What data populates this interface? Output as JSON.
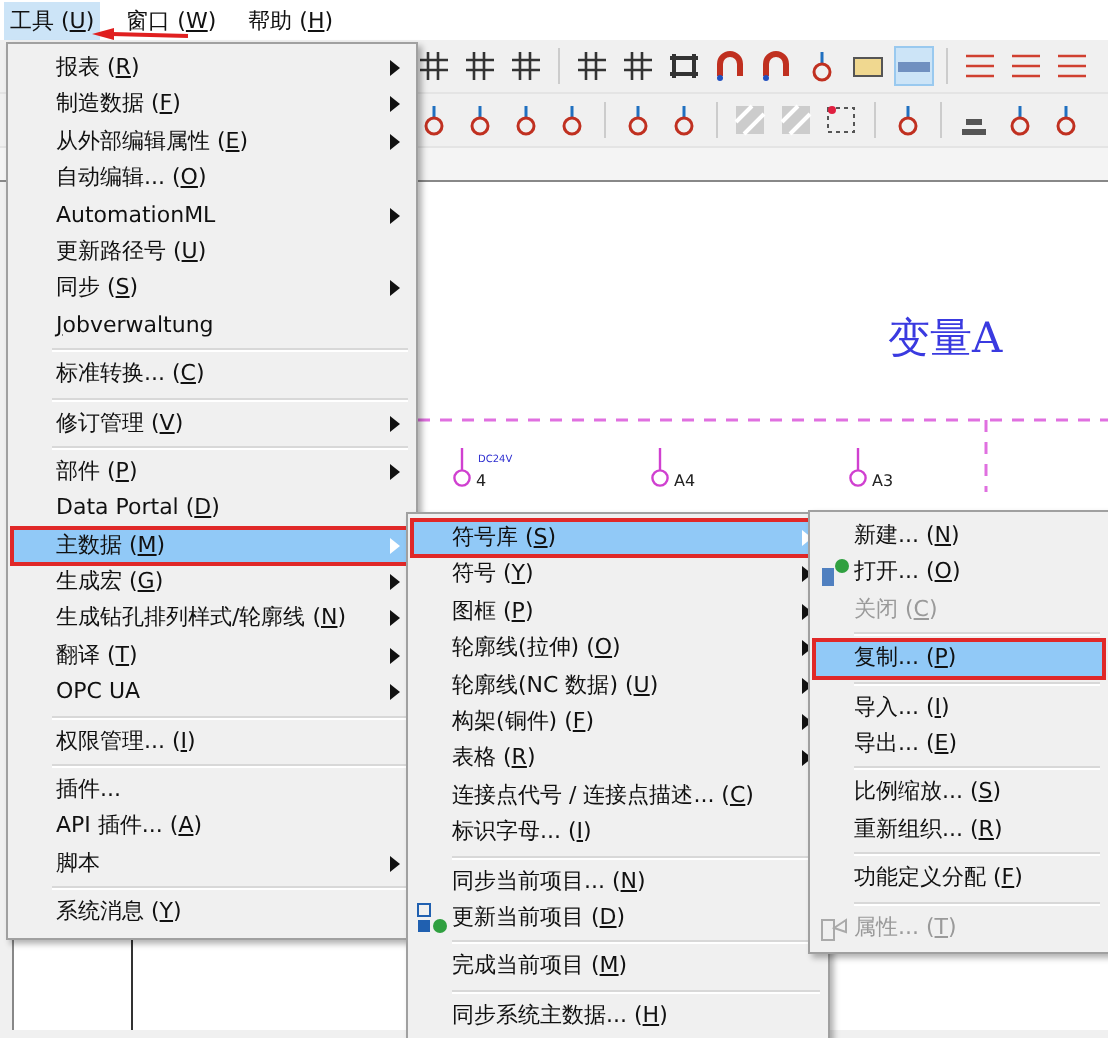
{
  "menu_bar": [
    {
      "before": "工具 (",
      "key": "U",
      "after": ")",
      "selected": true,
      "pointed": true
    },
    {
      "before": "窗口 (",
      "key": "W",
      "after": ")",
      "selected": false,
      "pointed": false
    },
    {
      "before": "帮助 (",
      "key": "H",
      "after": ")",
      "selected": false,
      "pointed": false
    }
  ],
  "tools_menu": {
    "items": [
      {
        "kind": "item",
        "before": "报表 (",
        "key": "R",
        "after": ")",
        "submenu": true,
        "selected": false,
        "marked": false
      },
      {
        "kind": "item",
        "before": "制造数据 (",
        "key": "F",
        "after": ")",
        "submenu": true,
        "selected": false,
        "marked": false
      },
      {
        "kind": "item",
        "before": "从外部编辑属性 (",
        "key": "E",
        "after": ")",
        "submenu": true,
        "selected": false,
        "marked": false
      },
      {
        "kind": "item",
        "before": "自动编辑... (",
        "key": "O",
        "after": ")",
        "submenu": false,
        "selected": false,
        "marked": false
      },
      {
        "kind": "item",
        "before": "AutomationML",
        "submenu": true,
        "selected": false,
        "marked": false
      },
      {
        "kind": "item",
        "before": "更新路径号 (",
        "key": "U",
        "after": ")",
        "submenu": false,
        "selected": false,
        "marked": false
      },
      {
        "kind": "item",
        "before": "同步 (",
        "key": "S",
        "after": ")",
        "submenu": true,
        "selected": false,
        "marked": false
      },
      {
        "kind": "item",
        "key": "J",
        "after": "obverwaltung",
        "submenu": false,
        "selected": false,
        "marked": false
      },
      {
        "kind": "separator"
      },
      {
        "kind": "item",
        "before": "标准转换... (",
        "key": "C",
        "after": ")",
        "submenu": false,
        "selected": false,
        "marked": false
      },
      {
        "kind": "separator"
      },
      {
        "kind": "item",
        "before": "修订管理 (",
        "key": "V",
        "after": ")",
        "submenu": true,
        "selected": false,
        "marked": false
      },
      {
        "kind": "separator"
      },
      {
        "kind": "item",
        "before": "部件 (",
        "key": "P",
        "after": ")",
        "submenu": true,
        "selected": false,
        "marked": false
      },
      {
        "kind": "item",
        "before": "Data Portal (",
        "key": "D",
        "after": ")",
        "submenu": false,
        "selected": false,
        "marked": false
      },
      {
        "kind": "item",
        "before": "主数据 (",
        "key": "M",
        "after": ")",
        "submenu": true,
        "selected": true,
        "marked": true
      },
      {
        "kind": "item",
        "before": "生成宏 (",
        "key": "G",
        "after": ")",
        "submenu": true,
        "selected": false,
        "marked": false
      },
      {
        "kind": "item",
        "before": "生成钻孔排列样式/轮廓线 (",
        "key": "N",
        "after": ")",
        "submenu": true,
        "selected": false,
        "marked": false
      },
      {
        "kind": "item",
        "before": "翻译 (",
        "key": "T",
        "after": ")",
        "submenu": true,
        "selected": false,
        "marked": false
      },
      {
        "kind": "item",
        "before": "OPC UA",
        "submenu": true,
        "selected": false,
        "marked": false
      },
      {
        "kind": "separator"
      },
      {
        "kind": "item",
        "before": "权限管理... (",
        "key": "I",
        "after": ")",
        "submenu": false,
        "selected": false,
        "marked": false
      },
      {
        "kind": "separator"
      },
      {
        "kind": "item",
        "before": "插件...",
        "submenu": false,
        "selected": false,
        "marked": false
      },
      {
        "kind": "item",
        "before": "API 插件... (",
        "key": "A",
        "after": ")",
        "submenu": false,
        "selected": false,
        "marked": false
      },
      {
        "kind": "item",
        "before": "脚本",
        "submenu": true,
        "selected": false,
        "marked": false
      },
      {
        "kind": "separator"
      },
      {
        "kind": "item",
        "before": "系统消息 (",
        "key": "Y",
        "after": ")",
        "submenu": false,
        "selected": false,
        "marked": false
      }
    ]
  },
  "master_data_menu": {
    "items": [
      {
        "kind": "item",
        "before": "符号库 (",
        "key": "S",
        "after": ")",
        "submenu": true,
        "selected": true,
        "marked": true
      },
      {
        "kind": "item",
        "before": "符号 (",
        "key": "Y",
        "after": ")",
        "submenu": true,
        "selected": false,
        "marked": false
      },
      {
        "kind": "item",
        "before": "图框 (",
        "key": "P",
        "after": ")",
        "submenu": true,
        "selected": false,
        "marked": false
      },
      {
        "kind": "item",
        "before": "轮廓线(拉伸) (",
        "key": "O",
        "after": ")",
        "submenu": true,
        "selected": false,
        "marked": false
      },
      {
        "kind": "item",
        "before": "轮廓线(NC 数据) (",
        "key": "U",
        "after": ")",
        "submenu": true,
        "selected": false,
        "marked": false
      },
      {
        "kind": "item",
        "before": "构架(铜件) (",
        "key": "F",
        "after": ")",
        "submenu": true,
        "selected": false,
        "marked": false
      },
      {
        "kind": "item",
        "before": "表格 (",
        "key": "R",
        "after": ")",
        "submenu": true,
        "selected": false,
        "marked": false
      },
      {
        "kind": "item",
        "before": "连接点代号 / 连接点描述... (",
        "key": "C",
        "after": ")",
        "submenu": false,
        "selected": false,
        "marked": false
      },
      {
        "kind": "item",
        "before": "标识字母... (",
        "key": "I",
        "after": ")",
        "submenu": false,
        "selected": false,
        "marked": false
      },
      {
        "kind": "separator"
      },
      {
        "kind": "item",
        "before": "同步当前项目... (",
        "key": "N",
        "after": ")",
        "submenu": false,
        "selected": false,
        "marked": false
      },
      {
        "kind": "iconitem",
        "before": "更新当前项目 (",
        "key": "D",
        "after": ")",
        "submenu": false,
        "selected": false,
        "marked": false
      },
      {
        "kind": "separator"
      },
      {
        "kind": "item",
        "before": "完成当前项目 (",
        "key": "M",
        "after": ")",
        "submenu": false,
        "selected": false,
        "marked": false
      },
      {
        "kind": "separator"
      },
      {
        "kind": "item",
        "before": "同步系统主数据... (",
        "key": "H",
        "after": ")",
        "submenu": false,
        "selected": false,
        "marked": false
      }
    ]
  },
  "symbol_library_menu": {
    "items": [
      {
        "kind": "item",
        "before": "新建... (",
        "key": "N",
        "after": ")",
        "submenu": false,
        "selected": false,
        "marked": false
      },
      {
        "kind": "iconitem",
        "before": "打开... (",
        "key": "O",
        "after": ")",
        "submenu": false,
        "selected": false,
        "marked": false
      },
      {
        "kind": "item",
        "before": "关闭 (",
        "key": "C",
        "after": ")",
        "submenu": false,
        "selected": false,
        "marked": false,
        "disabled": true
      },
      {
        "kind": "separator"
      },
      {
        "kind": "item",
        "before": "复制... (",
        "key": "P",
        "after": ")",
        "submenu": false,
        "selected": true,
        "marked": true
      },
      {
        "kind": "separator"
      },
      {
        "kind": "item",
        "before": "导入... (",
        "key": "I",
        "after": ")",
        "submenu": false,
        "selected": false,
        "marked": false
      },
      {
        "kind": "item",
        "before": "导出... (",
        "key": "E",
        "after": ")",
        "submenu": false,
        "selected": false,
        "marked": false
      },
      {
        "kind": "separator"
      },
      {
        "kind": "item",
        "before": "比例缩放... (",
        "key": "S",
        "after": ")",
        "submenu": false,
        "selected": false,
        "marked": false
      },
      {
        "kind": "item",
        "before": "重新组织... (",
        "key": "R",
        "after": ")",
        "submenu": false,
        "selected": false,
        "marked": false
      },
      {
        "kind": "separator"
      },
      {
        "kind": "item",
        "before": "功能定义分配 (",
        "key": "F",
        "after": ")",
        "submenu": false,
        "selected": false,
        "marked": false
      },
      {
        "kind": "separator"
      },
      {
        "kind": "iconitem",
        "before": "属性... (",
        "key": "T",
        "after": ")",
        "submenu": false,
        "selected": false,
        "marked": false,
        "disabled": true
      }
    ]
  },
  "drawing": {
    "title": "变量A",
    "terminals": [
      {
        "label": "4",
        "note": "DC24V"
      },
      {
        "label": "A4"
      },
      {
        "label": "A3"
      }
    ]
  }
}
